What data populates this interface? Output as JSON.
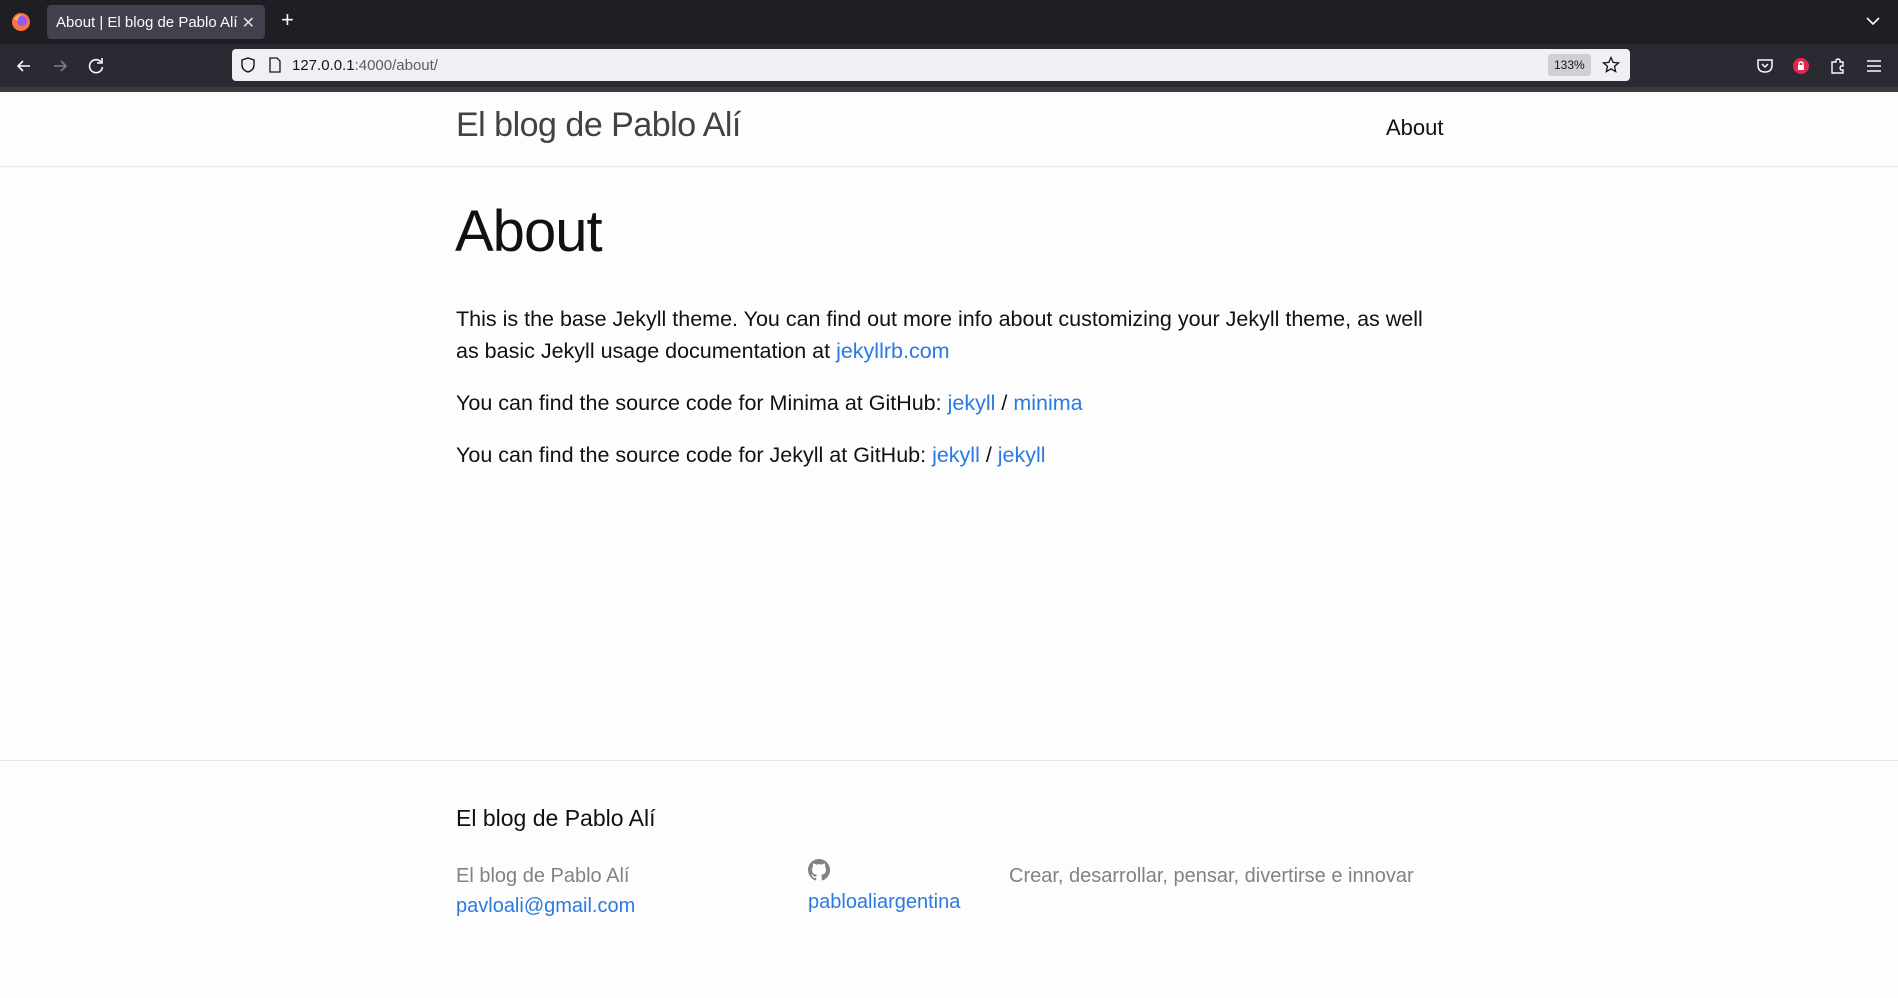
{
  "browser": {
    "tab_title": "About | El blog de Pablo Alí",
    "url_host": "127.0.0.1",
    "url_rest": ":4000/about/",
    "zoom": "133%"
  },
  "header": {
    "site_title": "El blog de Pablo Alí",
    "nav_about": "About"
  },
  "main": {
    "title": "About",
    "p1_text": "This is the base Jekyll theme. You can find out more info about customizing your Jekyll theme, as well as basic Jekyll usage documentation at ",
    "p1_link": "jekyllrb.com",
    "p2_text": "You can find the source code for Minima at GitHub: ",
    "p2_link1": "jekyll",
    "p2_sep": " / ",
    "p2_link2": "minima",
    "p3_text": "You can find the source code for Jekyll at GitHub: ",
    "p3_link1": "jekyll",
    "p3_sep": " / ",
    "p3_link2": "jekyll"
  },
  "footer": {
    "heading": "El blog de Pablo Alí",
    "name": "El blog de Pablo Alí",
    "email": "pavloali@gmail.com",
    "github_user": "pabloaliargentina",
    "description": "Crear, desarrollar, pensar, divertirse e innovar"
  },
  "colors": {
    "link": "#2a7ae2",
    "muted": "#828282",
    "chrome_dark": "#1f1e25"
  }
}
